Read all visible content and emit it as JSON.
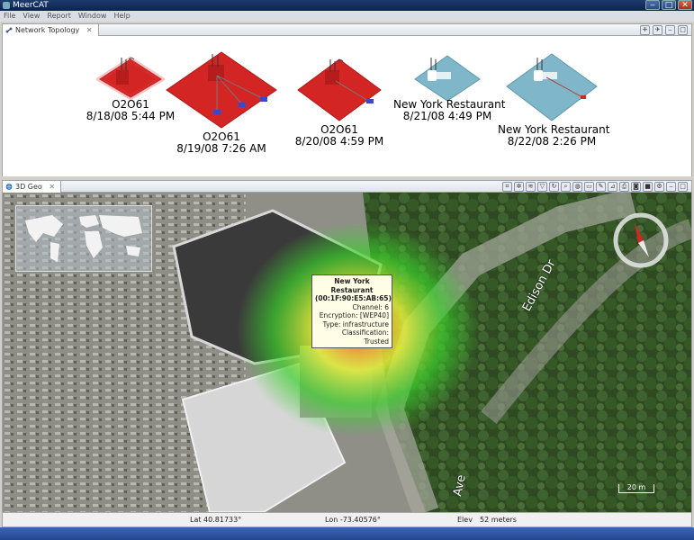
{
  "window": {
    "title": "MeerCAT",
    "min": "‒",
    "max": "□",
    "close": "✕"
  },
  "menu": [
    "File",
    "View",
    "Report",
    "Window",
    "Help"
  ],
  "topology": {
    "tab_label": "Network Topology",
    "tab_close": "✕",
    "nodes": [
      {
        "name": "O2O61",
        "date": "8/18/08 5:44 PM",
        "color": "#d42525"
      },
      {
        "name": "O2O61",
        "date": "8/19/08 7:26 AM",
        "color": "#d42525"
      },
      {
        "name": "O2O61",
        "date": "8/20/08 4:59 PM",
        "color": "#d42525"
      },
      {
        "name": "New York Restaurant",
        "date": "8/21/08 4:49 PM",
        "color": "#7fb6c9"
      },
      {
        "name": "New York Restaurant",
        "date": "8/22/08 2:26 PM",
        "color": "#7fb6c9"
      }
    ]
  },
  "geo": {
    "tab_label": "3D Geo",
    "tab_close": "✕",
    "tooltip": {
      "title": "New York Restaurant",
      "mac": "(00:1F:90:E5:AB:65)",
      "channel": "Channel: 6",
      "encryption": "Encryption: [WEP40]",
      "type": "Type: infrastructure",
      "classification": "Classification: Trusted"
    },
    "street_label": "Edison Dr",
    "street_label_2": "Ave",
    "scale": "20 m",
    "status": {
      "lat": "Lat 40.81733°",
      "lon": "Lon -73.40576°",
      "elev_label": "Elev",
      "elev_value": "52 meters"
    }
  },
  "colors": {
    "topology_red": "#d42525",
    "topology_blue": "#7fb6c9",
    "heat_green": "#3bd12b",
    "heat_yellow": "#e6f03a",
    "heat_red": "#e6342a"
  }
}
